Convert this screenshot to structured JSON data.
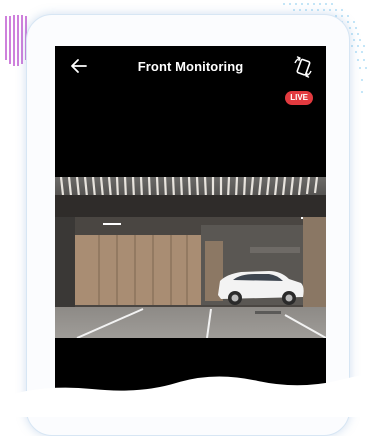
{
  "header": {
    "title": "Front Monitoring",
    "back_icon": "arrow-left-icon",
    "rotate_icon": "screen-rotate-icon"
  },
  "stream": {
    "live_label": "LIVE",
    "live_color": "#e23a3f"
  },
  "colors": {
    "screen_background": "#000000",
    "accent_lines": "#c66ad6",
    "accent_dots": "#7ec8f0"
  }
}
